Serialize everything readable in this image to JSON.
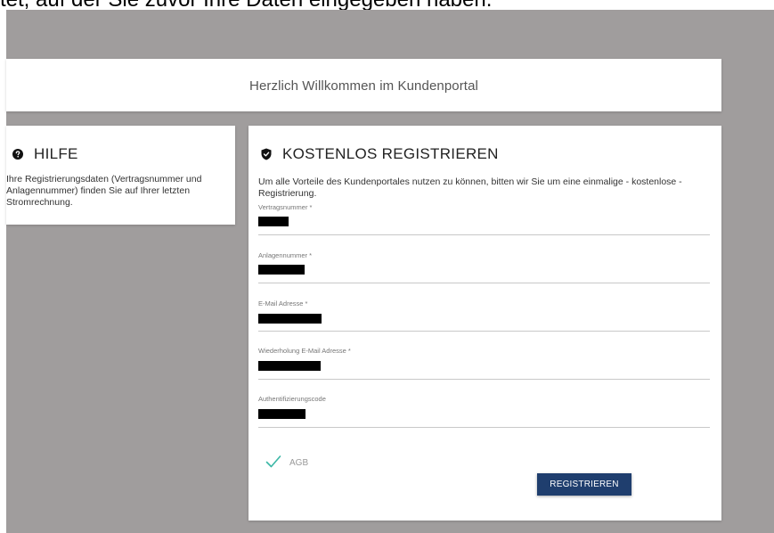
{
  "page_caption": "tet, auf der Sie zuvor Ihre Daten eingegeben haben.",
  "welcome": {
    "title": "Herzlich Willkommen im Kundenportal"
  },
  "help": {
    "heading": "HILFE",
    "text": "Ihre Registrierungsdaten (Vertragsnummer und Anlagennummer) finden Sie auf Ihrer letzten Stromrechnung."
  },
  "registration": {
    "heading": "KOSTENLOS REGISTRIEREN",
    "intro": "Um alle Vorteile des Kundenportales nutzen zu können, bitten wir Sie um eine einmalige - kostenlose - Registrierung.",
    "fields": [
      {
        "label": "Vertragsnummer *",
        "value": "redacted"
      },
      {
        "label": "Anlagennummer *",
        "value": "redacted"
      },
      {
        "label": "E-Mail Adresse *",
        "value": "redacted"
      },
      {
        "label": "Wiederholung E-Mail Adresse *",
        "value": "redacted"
      },
      {
        "label": "Authentifizierungscode",
        "value": "redacted"
      }
    ],
    "agb_label": "AGB",
    "agb_checked": true,
    "submit_label": "REGISTRIEREN"
  },
  "icons": {
    "help": "question-circle-icon",
    "registration": "shield-icon",
    "agb": "check-icon"
  },
  "colors": {
    "background": "#a09d9d",
    "button": "#1f3e6e",
    "check": "#3bb7a6"
  }
}
